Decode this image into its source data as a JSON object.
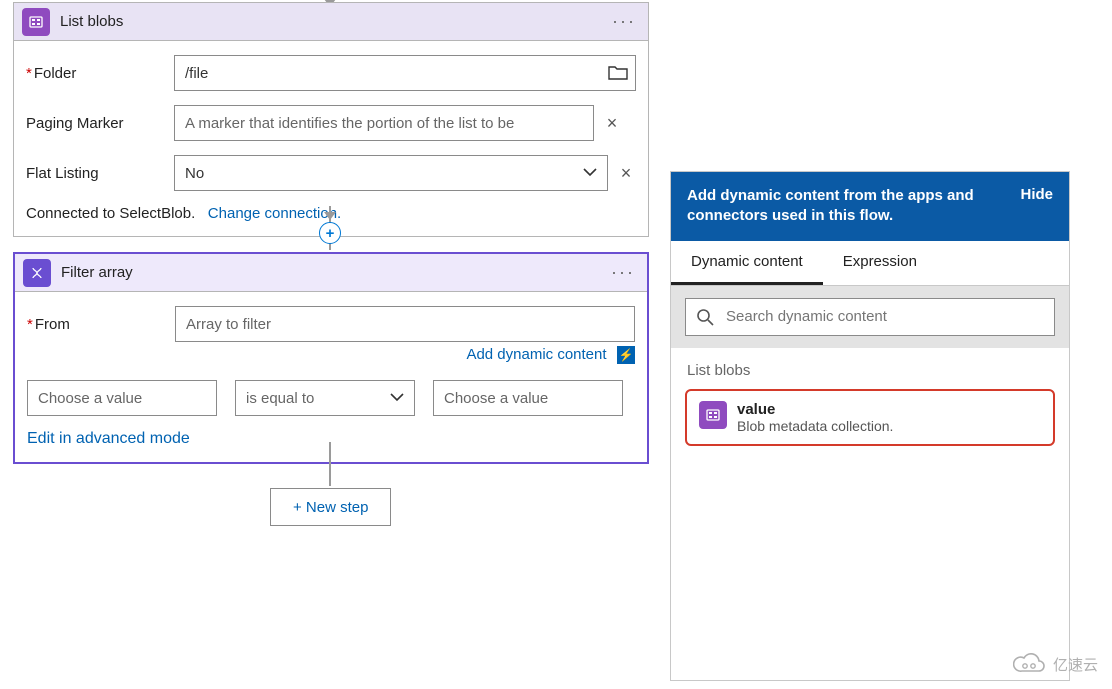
{
  "listBlobs": {
    "title": "List blobs",
    "folder_label": "Folder",
    "folder_value": "/file",
    "paging_label": "Paging Marker",
    "paging_placeholder": "A marker that identifies the portion of the list to be",
    "flat_label": "Flat Listing",
    "flat_value": "No",
    "connected_text": "Connected to SelectBlob.",
    "change_conn": "Change connection."
  },
  "filterArray": {
    "title": "Filter array",
    "from_label": "From",
    "from_placeholder": "Array to filter",
    "add_dynamic": "Add dynamic content",
    "choose_value": "Choose a value",
    "operator": "is equal to",
    "edit_advanced": "Edit in advanced mode"
  },
  "newStep": "+ New step",
  "dynamicPanel": {
    "header": "Add dynamic content from the apps and connectors used in this flow.",
    "hide": "Hide",
    "tabs": {
      "dynamic": "Dynamic content",
      "expression": "Expression"
    },
    "search_placeholder": "Search dynamic content",
    "section": "List blobs",
    "item": {
      "title": "value",
      "subtitle": "Blob metadata collection."
    }
  },
  "brand": "亿速云"
}
